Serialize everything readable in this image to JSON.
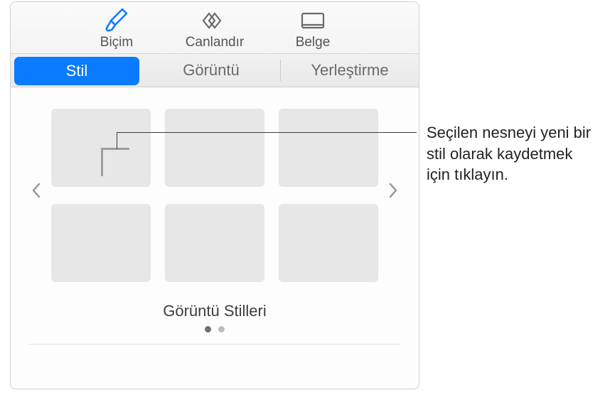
{
  "toolbar": {
    "format_label": "Biçim",
    "animate_label": "Canlandır",
    "document_label": "Belge"
  },
  "tabs": {
    "style": "Stil",
    "image": "Görüntü",
    "arrange": "Yerleştirme"
  },
  "styles": {
    "section_title": "Görüntü Stilleri"
  },
  "callout": {
    "text": "Seçilen nesneyi yeni bir stil olarak kaydetmek için tıklayın."
  }
}
